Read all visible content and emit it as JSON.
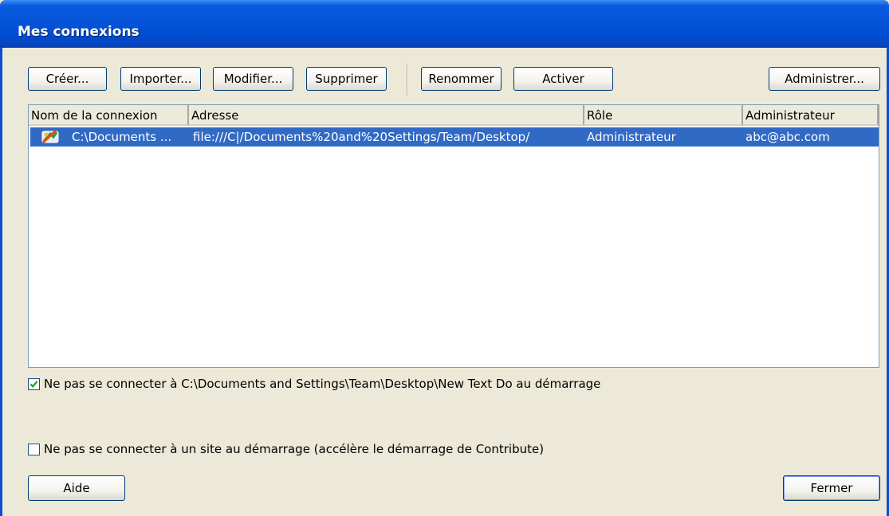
{
  "window": {
    "title": "Mes connexions"
  },
  "toolbar": {
    "create": "Créer...",
    "import": "Importer...",
    "modify": "Modifier...",
    "delete": "Supprimer",
    "rename": "Renommer",
    "activate": "Activer",
    "administer": "Administrer..."
  },
  "list": {
    "columns": [
      "Nom de la connexion",
      "Adresse",
      "Rôle",
      "Administrateur"
    ],
    "rows": [
      {
        "icon": "site-connection-icon",
        "name": "C:\\Documents ...",
        "address": "file:///C|/Documents%20and%20Settings/Team/Desktop/",
        "role": "Administrateur",
        "admin": "abc@abc.com",
        "selected": true
      }
    ]
  },
  "options": {
    "no_connect_specific": {
      "checked": true,
      "label": "Ne pas se connecter à C:\\Documents and Settings\\Team\\Desktop\\New Text Do au démarrage"
    },
    "no_connect_any": {
      "checked": false,
      "label": "Ne pas se connecter à un site au démarrage (accélère le démarrage de Contribute)"
    }
  },
  "footer": {
    "help": "Aide",
    "close": "Fermer"
  },
  "colors": {
    "selection": "#316ac5",
    "dialog": "#ece9d8",
    "titlebar": "#0453d8"
  }
}
